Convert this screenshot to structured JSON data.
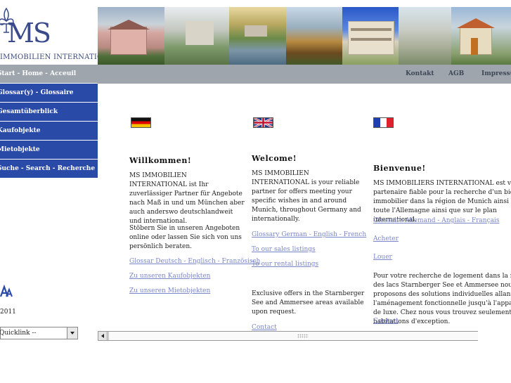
{
  "logo": {
    "text": "MS",
    "company": "IMMOBILIEN INTERNATIONAL",
    "icon": "fleur-de-lis-icon"
  },
  "nav": {
    "items": [
      {
        "label": "Start - Home - Acceuil",
        "active": true
      },
      {
        "label": "Glossar(y) - Glossaire",
        "active": false
      },
      {
        "label": "Gesamtüberblick",
        "active": false
      },
      {
        "label": "Kaufobjekte",
        "active": false
      },
      {
        "label": "Mietobjekte",
        "active": false
      },
      {
        "label": "Suche - Search - Recherche",
        "active": false
      }
    ]
  },
  "sidebar": {
    "year": "2011",
    "quicklink": "Quicklink --"
  },
  "topbar": {
    "links": [
      "Kontakt",
      "AGB",
      "Impressum"
    ]
  },
  "german": {
    "heading": "Willkommen!",
    "intro": "MS IMMOBILIEN INTERNATIONAL ist Ihr zuverlässiger Partner für Angebote nach Maß in und um München aber auch anderswo deutschlandweit und international.",
    "browse": "Stöbern Sie in unseren Angeboten online oder lassen Sie sich von uns persönlich beraten.",
    "links": [
      "Glossar Deutsch - Englisch - Französisch",
      "Zu unseren Kaufobjekten",
      "Zu unseren Mietobjekten"
    ]
  },
  "english": {
    "heading": "Welcome!",
    "intro": "MS IMMOBILIEN INTERNATIONAL is your reliable partner for offers meeting your specific wishes in and around Munich, throughout Germany and internationally.",
    "links": [
      "Glossary German - English - French",
      "To our sales listings",
      "To our rental listings"
    ],
    "exclusive": "Exclusive offers in the Starnberger See and Ammersee areas available upon request.",
    "contact": "Contact"
  },
  "french": {
    "heading": "Bienvenue!",
    "intro": "MS IMMOBILIERS INTERNATIONAL est votre partenaire fiable pour la recherche d'un bien immobilier dans la région de Munich ainsi que dans toute l'Allemagne ainsi que sur le plan international.",
    "links": [
      "Glossaire Allemand - Anglais - Français",
      "Acheter",
      "Louer"
    ],
    "search": "Pour votre recherche de logement dans la région des lacs Starnberger See et Ammersee nous vous proposons des solutions individuelles allant de l'aménagement fonctionnelle jusqu'à l'appartement de luxe. Chez nous vous trouvez seulement des habitations d'exception.",
    "contact": "Contact"
  },
  "colors": {
    "nav_blue": "#2a4aa8",
    "nav_active": "#9ea5ad",
    "link": "#7a86c8",
    "logo": "#3a4a8a"
  }
}
